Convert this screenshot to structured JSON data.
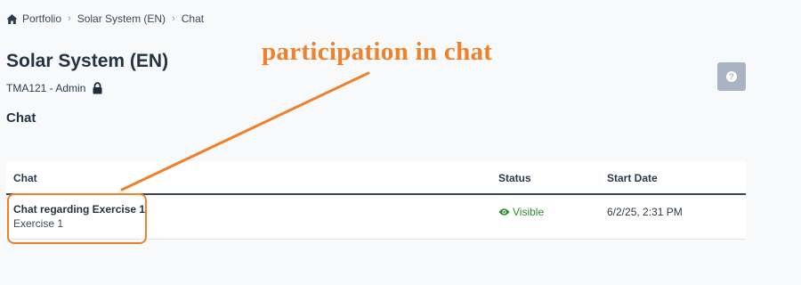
{
  "breadcrumb": {
    "items": [
      "Portfolio",
      "Solar System (EN)",
      "Chat"
    ],
    "separator": "›"
  },
  "page": {
    "title": "Solar System (EN)",
    "subtitle": "TMA121 - Admin",
    "section_title": "Chat"
  },
  "help_button": {
    "label": "?"
  },
  "annotation": {
    "text": "participation in chat",
    "color": "#f0802a"
  },
  "table": {
    "columns": [
      "Chat",
      "Status",
      "Start Date"
    ],
    "rows": [
      {
        "name": "Chat regarding Exercise 1",
        "sub": "Exercise 1",
        "status": "Visible",
        "start_date": "6/2/25, 2:31 PM"
      }
    ]
  },
  "colors": {
    "accent": "#f0802a",
    "status_visible": "#2e8b2e",
    "background": "#f8f9fb"
  }
}
